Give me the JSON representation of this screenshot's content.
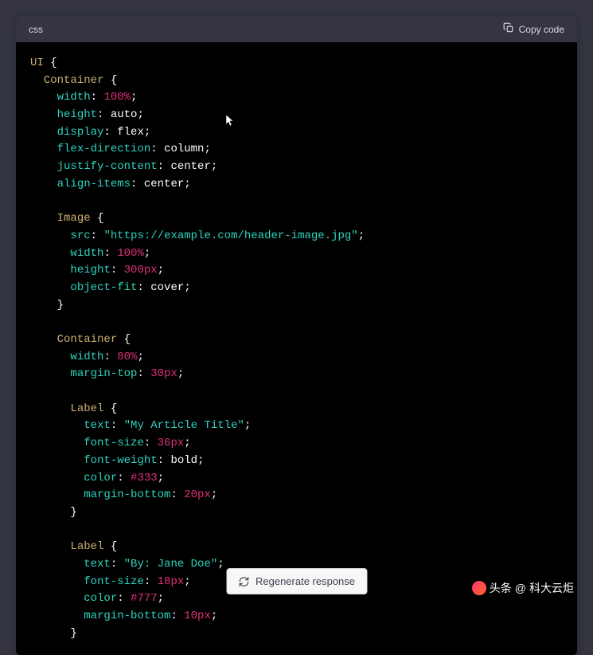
{
  "header": {
    "lang": "css",
    "copy_label": "Copy code"
  },
  "code": {
    "sel_ui": "UI",
    "sel_container": "Container",
    "sel_image": "Image",
    "sel_label": "Label",
    "p_width": "width",
    "p_height": "height",
    "p_display": "display",
    "p_flexdir": "flex-direction",
    "p_justify": "justify-content",
    "p_align": "align-items",
    "p_src": "src",
    "p_objfit": "object-fit",
    "p_mtop": "margin-top",
    "p_text": "text",
    "p_fsize": "font-size",
    "p_fweight": "font-weight",
    "p_color": "color",
    "p_mbottom": "margin-bottom",
    "v_100pc": "100%",
    "v_80pc": "80%",
    "v_auto": "auto",
    "v_flex": "flex",
    "v_column": "column",
    "v_center": "center",
    "v_url": "\"https://example.com/header-image.jpg\"",
    "v_300px": "300px",
    "v_cover": "cover",
    "v_30px": "30px",
    "v_title": "\"My Article Title\"",
    "v_36px": "36px",
    "v_bold": "bold",
    "v_333": "#333",
    "v_20px": "20px",
    "v_by": "\"By: Jane Doe\"",
    "v_18px": "18px",
    "v_777": "#777",
    "v_10px": "10px"
  },
  "regen_label": "Regenerate response",
  "watermark": {
    "prefix": "头条",
    "at": "@",
    "name": "科大云炬"
  }
}
